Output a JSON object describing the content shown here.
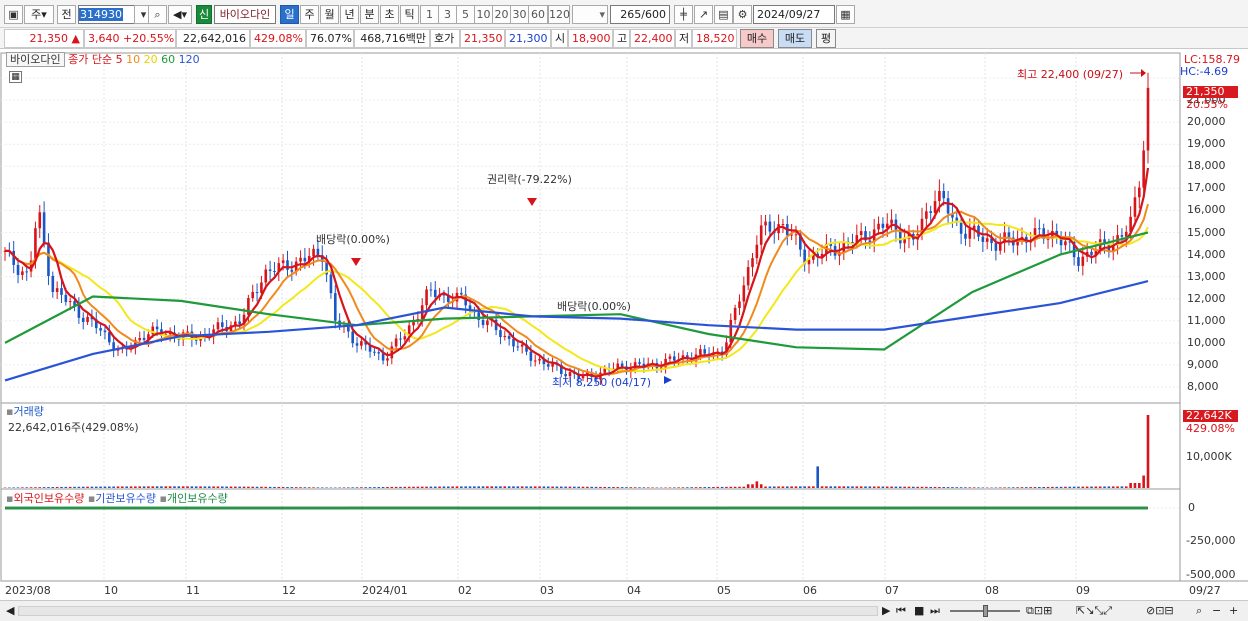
{
  "toolbar": {
    "period_select": "주",
    "prev_label": "전",
    "code": "314930",
    "credit_badge": "신",
    "name": "바이오다인",
    "periods": [
      "일",
      "주",
      "월",
      "년",
      "분",
      "초",
      "틱"
    ],
    "active_period": "일",
    "ticks": [
      "1",
      "3",
      "5",
      "10",
      "20",
      "30",
      "60",
      "120"
    ],
    "count": "265",
    "count_total": "/600",
    "date": "2024/09/27"
  },
  "info": {
    "price": "21,350",
    "change_arrow": "▲",
    "change": "3,640",
    "change_pct": "+20.55%",
    "volume": "22,642,016",
    "volume_ratio": "429.08%",
    "turnover": "76.07%",
    "amount": "468,716백만",
    "quote_label": "호가",
    "ask": "21,350",
    "bid": "21,300",
    "open_label": "시",
    "open": "18,900",
    "high_label": "고",
    "high": "22,400",
    "low_label": "저",
    "low": "18,520",
    "sell_btn": "매수",
    "buy_btn": "매도",
    "eval_btn": "평"
  },
  "price_legend": {
    "name": "바이오다인",
    "label": "종가 단순",
    "ma": [
      "5",
      "10",
      "20",
      "60",
      "120"
    ]
  },
  "price_axis": [
    "22,000",
    "21,000",
    "20,000",
    "19,000",
    "18,000",
    "17,000",
    "16,000",
    "15,000",
    "14,000",
    "13,000",
    "12,000",
    "11,000",
    "10,000",
    "9,000",
    "8,000"
  ],
  "lc_hc": {
    "lc": "LC:158.79",
    "hc": "HC:-4.69"
  },
  "current_price_badge": "21,350",
  "current_pct": "20.55%",
  "annotations": {
    "high": "최고 22,400 (09/27)",
    "low": "최저 8,250 (04/17)",
    "rights": "권리락(-79.22%)",
    "dividend": "배당락(0.00%)",
    "dividend2": "배당락(0.00%)"
  },
  "volume_panel": {
    "title": "거래량",
    "value_line": "22,642,016주(429.08%)",
    "badge": "22,642K",
    "badge_pct": "429.08%",
    "axis": "10,000K"
  },
  "holder_panel": {
    "foreign": "외국인보유수량",
    "institution": "기관보유수량",
    "individual": "개인보유수량",
    "axis": [
      "0",
      "-250,000",
      "-500,000"
    ]
  },
  "x_labels": [
    "2023/08",
    "10",
    "11",
    "12",
    "2024/01",
    "02",
    "03",
    "04",
    "05",
    "06",
    "07",
    "08",
    "09",
    "09/27"
  ],
  "colors": {
    "up": "#d8141b",
    "down": "#1a56c6",
    "ma5": "#d8141b",
    "ma10": "#f08a1c",
    "ma20": "#f2e81a",
    "ma60": "#1f9a3a",
    "ma120": "#2a54d6"
  },
  "chart_data": {
    "type": "line",
    "title": "바이오다인",
    "ylabel": "",
    "ylim": [
      7700,
      22800
    ],
    "x": [
      "2023/08",
      "2023/09",
      "2023/10",
      "2023/11",
      "2023/12",
      "2024/01",
      "2024/02",
      "2024/03",
      "2024/04",
      "2024/05",
      "2024/06",
      "2024/07",
      "2024/08",
      "2024/09"
    ],
    "series": [
      {
        "name": "종가",
        "values": [
          14000,
          11500,
          9800,
          10600,
          10500,
          13200,
          9600,
          12200,
          8800,
          9100,
          9400,
          14300,
          14600,
          21350
        ]
      },
      {
        "name": "60",
        "values": [
          10000,
          12100,
          11900,
          11300,
          10800,
          11100,
          11200,
          11300,
          10400,
          9800,
          9700,
          12300,
          14000,
          15000
        ]
      },
      {
        "name": "120",
        "values": [
          8300,
          9500,
          10300,
          10500,
          10800,
          11600,
          11200,
          11100,
          10800,
          10600,
          10600,
          11200,
          11800,
          12800
        ]
      }
    ]
  }
}
